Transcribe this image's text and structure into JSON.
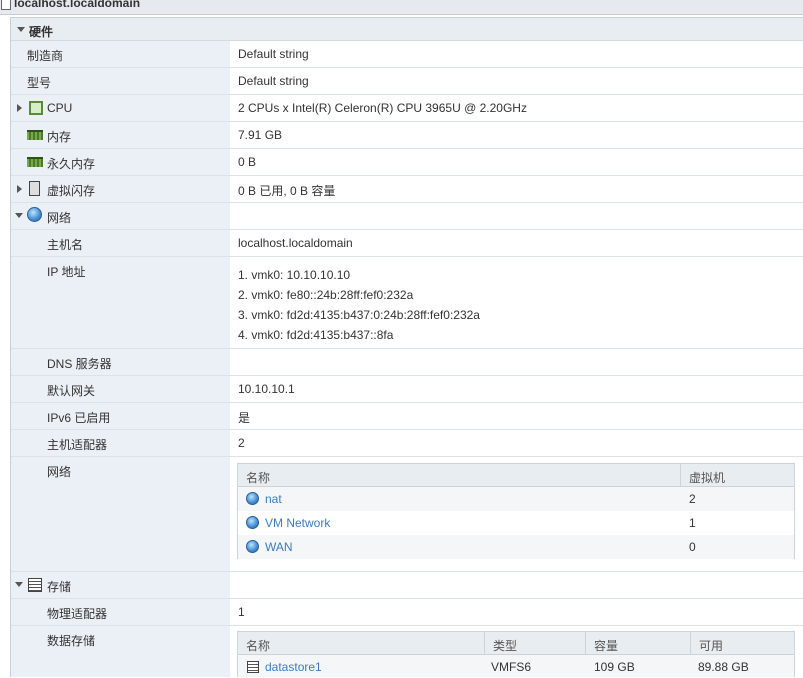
{
  "window": {
    "title": "localhost.localdomain"
  },
  "hardware": {
    "title": "硬件",
    "rows": {
      "manufacturer": {
        "label": "制造商",
        "value": "Default string"
      },
      "model": {
        "label": "型号",
        "value": "Default string"
      },
      "cpu": {
        "label": "CPU",
        "value": "2 CPUs x Intel(R) Celeron(R) CPU 3965U @ 2.20GHz"
      },
      "memory": {
        "label": "内存",
        "value": "7.91 GB"
      },
      "pmem": {
        "label": "永久内存",
        "value": "0 B"
      },
      "vflash": {
        "label": "虚拟闪存",
        "value": "0 B 已用, 0 B 容量"
      },
      "network": {
        "label": "网络"
      },
      "hostname": {
        "label": "主机名",
        "value": "localhost.localdomain"
      },
      "ip": {
        "label": "IP 地址",
        "values": [
          "1. vmk0: 10.10.10.10",
          "2. vmk0: fe80::24b:28ff:fef0:232a",
          "3. vmk0: fd2d:4135:b437:0:24b:28ff:fef0:232a",
          "4. vmk0: fd2d:4135:b437::8fa"
        ]
      },
      "dns": {
        "label": "DNS 服务器",
        "value": ""
      },
      "gateway": {
        "label": "默认网关",
        "value": "10.10.10.1"
      },
      "ipv6": {
        "label": "IPv6 已启用",
        "value": "是"
      },
      "adapters": {
        "label": "主机适配器",
        "value": "2"
      },
      "networks": {
        "label": "网络",
        "columns": [
          "名称",
          "虚拟机"
        ],
        "items": [
          {
            "name": "nat",
            "vms": "2"
          },
          {
            "name": "VM Network",
            "vms": "1"
          },
          {
            "name": "WAN",
            "vms": "0"
          }
        ]
      }
    }
  },
  "storage": {
    "title": "存储",
    "physical_adapters": {
      "label": "物理适配器",
      "value": "1"
    },
    "datastores": {
      "label": "数据存储",
      "columns": [
        "名称",
        "类型",
        "容量",
        "可用"
      ],
      "items": [
        {
          "name": "datastore1",
          "type": "VMFS6",
          "capacity": "109 GB",
          "free": "89.88 GB"
        }
      ]
    }
  },
  "icons": {
    "cpu": "cpu-chip-icon",
    "memory": "memory-icon",
    "pmem": "memory-icon",
    "vflash": "flash-drive-icon",
    "network": "globe-network-icon",
    "storage": "disk-storage-icon",
    "datastore": "datastore-icon"
  }
}
